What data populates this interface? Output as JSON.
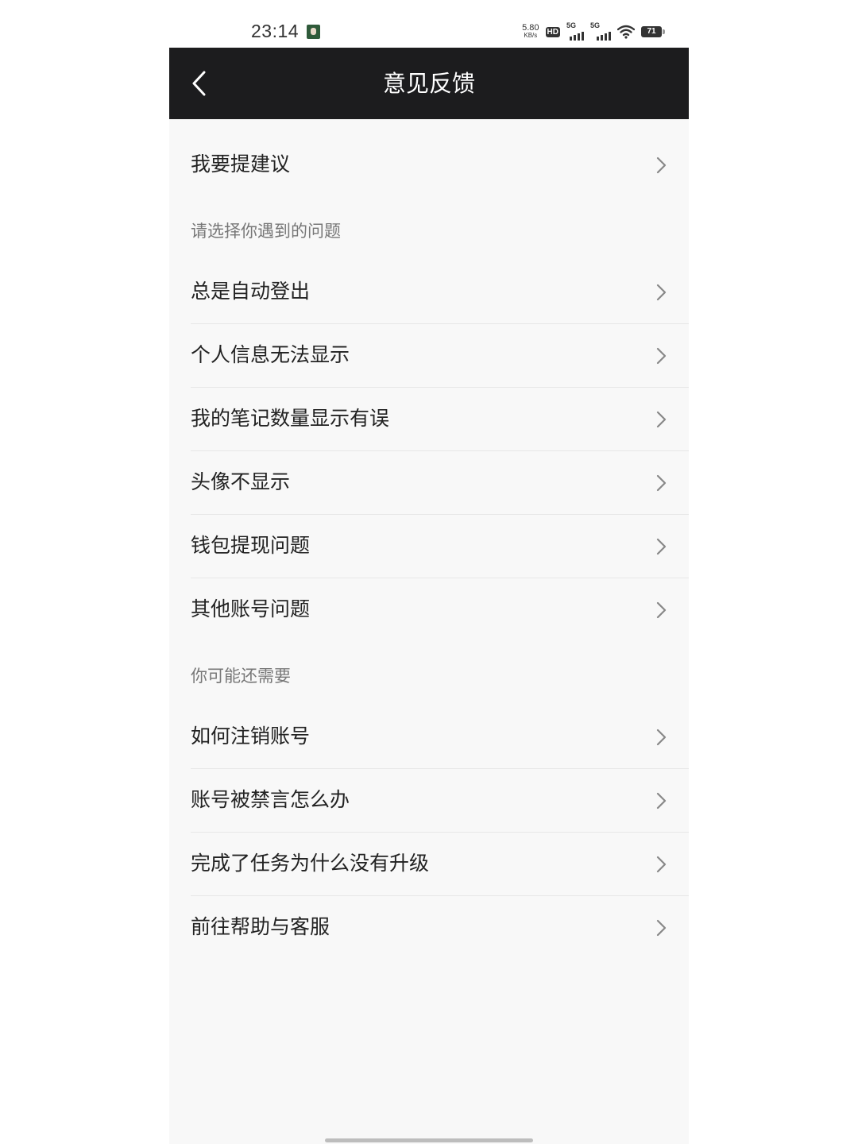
{
  "status_bar": {
    "time": "23:14",
    "net_speed_value": "5.80",
    "net_speed_unit": "KB/s",
    "hd_label": "HD",
    "signal_1_label": "5G",
    "signal_2_label": "5G",
    "battery_level": "71"
  },
  "header": {
    "title": "意见反馈"
  },
  "suggest_row": {
    "label": "我要提建议"
  },
  "section_problems": {
    "title": "请选择你遇到的问题",
    "items": [
      {
        "label": "总是自动登出"
      },
      {
        "label": "个人信息无法显示"
      },
      {
        "label": "我的笔记数量显示有误"
      },
      {
        "label": "头像不显示"
      },
      {
        "label": "钱包提现问题"
      },
      {
        "label": "其他账号问题"
      }
    ]
  },
  "section_more": {
    "title": "你可能还需要",
    "items": [
      {
        "label": "如何注销账号"
      },
      {
        "label": "账号被禁言怎么办"
      },
      {
        "label": "完成了任务为什么没有升级"
      },
      {
        "label": "前往帮助与客服"
      }
    ]
  },
  "colors": {
    "nav_background": "#1c1c1e",
    "page_background": "#f8f8f8",
    "text_primary": "#222222",
    "text_secondary": "#777777"
  }
}
